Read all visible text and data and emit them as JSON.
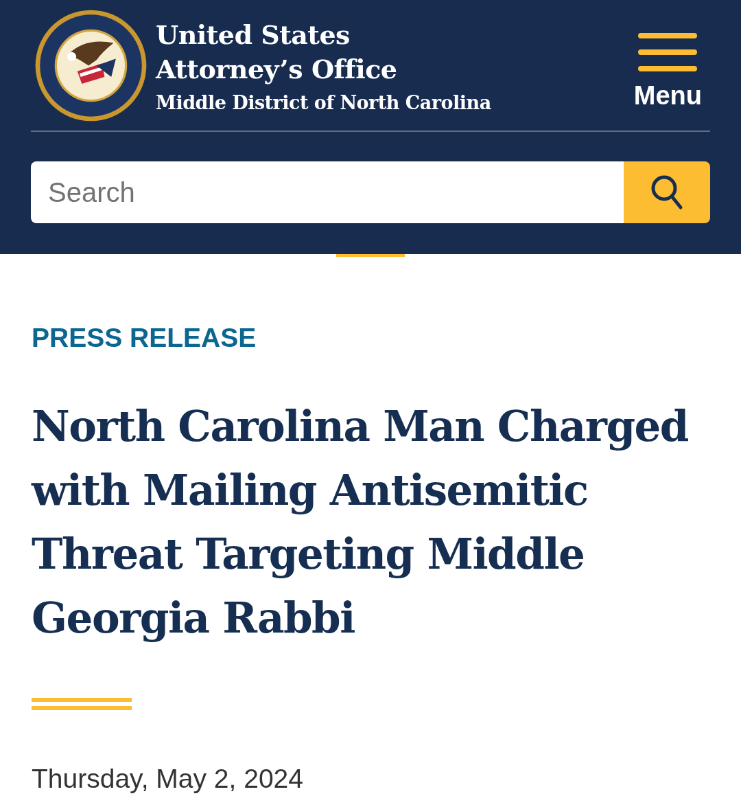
{
  "header": {
    "title_lines": [
      "United States",
      "Attorney’s Office"
    ],
    "subtitle": "Middle District of North Carolina",
    "menu_label": "Menu"
  },
  "search": {
    "placeholder": "Search"
  },
  "article": {
    "eyebrow": "PRESS RELEASE",
    "title": "North Carolina Man Charged with Mailing Antisemitic Threat Targeting Middle Georgia Rabbi",
    "date": "Thursday, May 2, 2024"
  }
}
